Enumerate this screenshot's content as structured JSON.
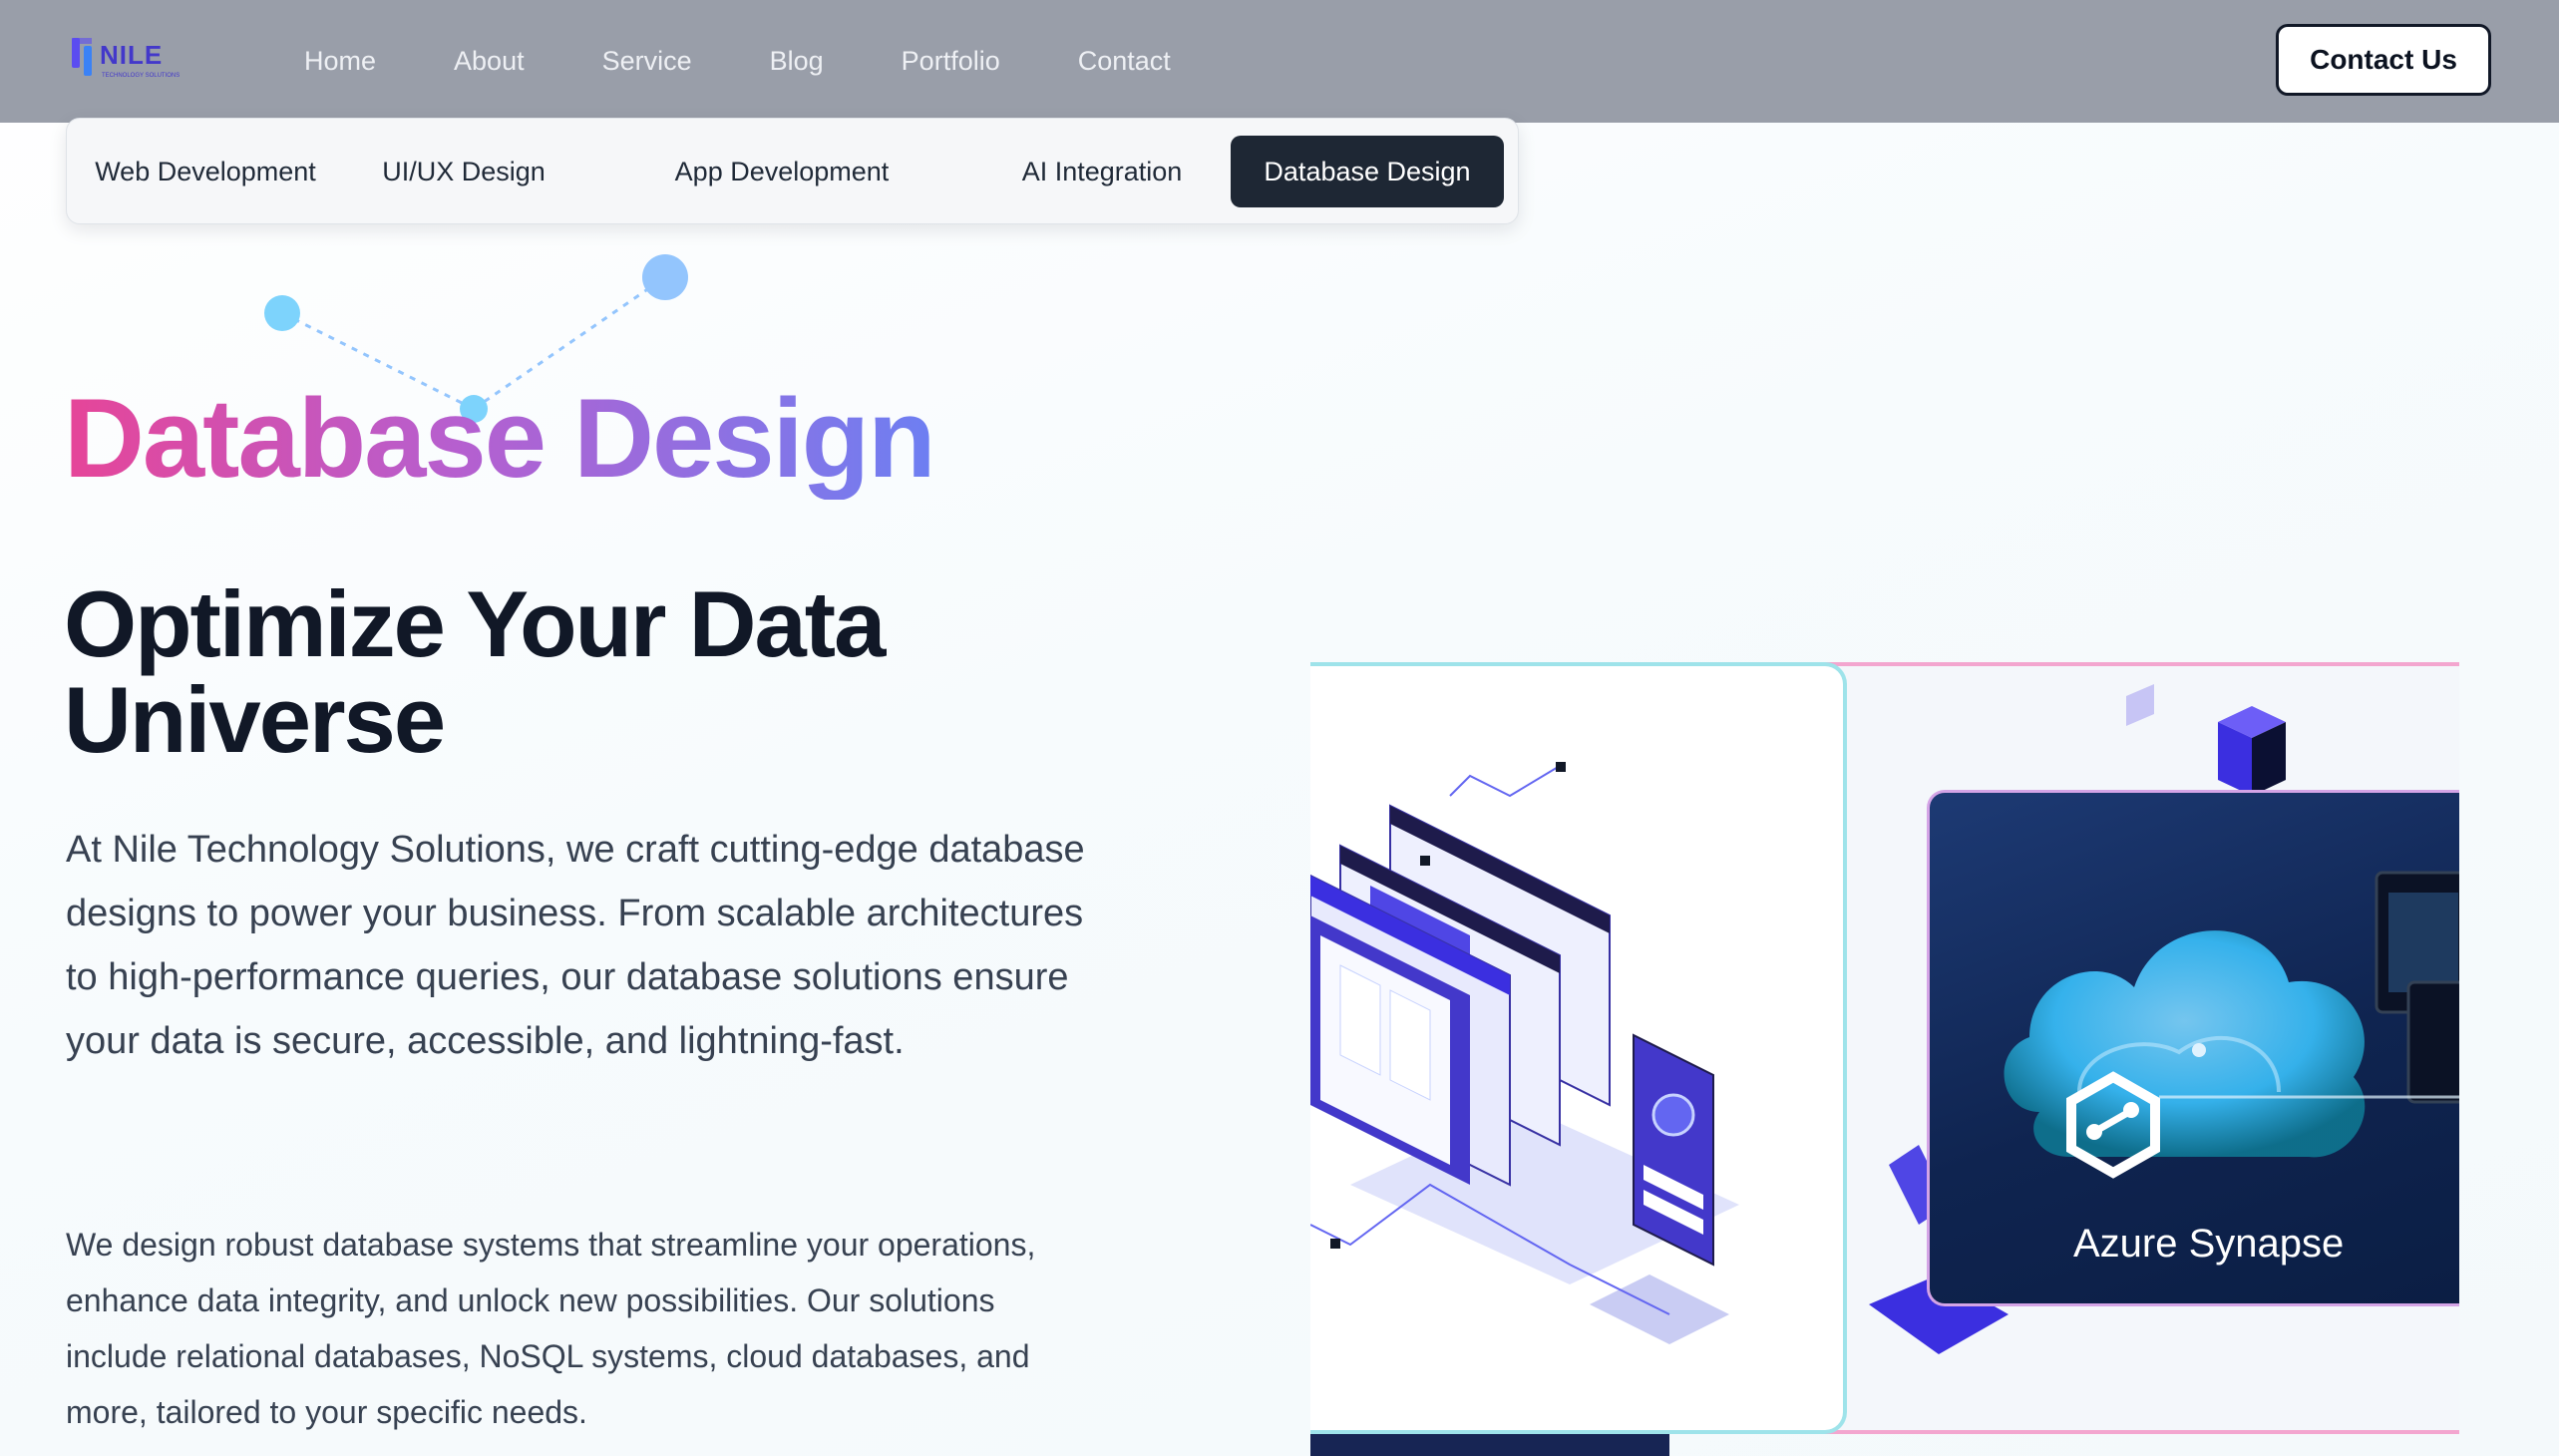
{
  "brand": {
    "name": "NILE",
    "tagline": "TECHNOLOGY SOLUTIONS"
  },
  "nav": {
    "items": [
      {
        "label": "Home"
      },
      {
        "label": "About"
      },
      {
        "label": "Service"
      },
      {
        "label": "Blog"
      },
      {
        "label": "Portfolio"
      },
      {
        "label": "Contact"
      }
    ],
    "cta_label": "Contact Us"
  },
  "service_tabs": {
    "items": [
      {
        "label": "Web Development"
      },
      {
        "label": "UI/UX Design"
      },
      {
        "label": "App Development"
      },
      {
        "label": "AI Integration"
      },
      {
        "label": "Database Design"
      }
    ],
    "active": "Database Design"
  },
  "hero": {
    "title": "Database Design",
    "subtitle": "Optimize Your Data Universe",
    "paragraph_1": "At Nile Technology Solutions, we craft cutting-edge database designs to power your business. From scalable architectures to high-performance queries, our database solutions ensure your data is secure, accessible, and lightning-fast.",
    "paragraph_2": "We design robust database systems that streamline your operations, enhance data integrity, and unlock new possibilities. Our solutions include relational databases, NoSQL systems, cloud databases, and more, tailored to your specific needs."
  },
  "gallery": {
    "card_2_label": "Azure Synapse"
  },
  "colors": {
    "header_bg": "#999ea9",
    "active_tab_bg": "#1e2734",
    "title_gradient_start": "#e64598",
    "title_gradient_end": "#6d7ff2",
    "accent_blue": "#4a3df0"
  }
}
